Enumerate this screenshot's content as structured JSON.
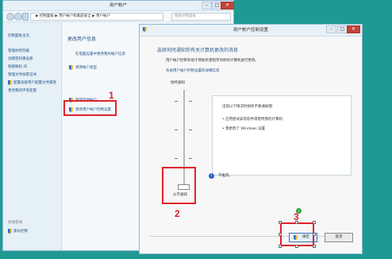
{
  "back_window": {
    "title": "用户帐户",
    "address": "▶ 控制面板 ▶ 用户帐户和家庭安全 ▶ 用户帐户",
    "search_placeholder": "搜索控制面板",
    "buttons": [
      "–",
      "□",
      "✕"
    ],
    "sidebar": {
      "items": [
        "控制面板主页",
        "管理你的凭据",
        "创建密码重设盘",
        "链接联机 ID",
        "管理文件加密证书",
        "配置高级用户配置文件属性",
        "更改我的环境变量"
      ],
      "footer_label": "另请参阅",
      "footer_link": "家长控制"
    },
    "main": {
      "heading": "更改用户信息",
      "links": [
        "在电脑设置中更改我的帐户信息",
        "更改帐户类型",
        "管理其他帐户",
        "更改用户帐户控制设置"
      ]
    }
  },
  "front_window": {
    "title": "用户帐户控制设置",
    "buttons": [
      "–",
      "□",
      "✕"
    ],
    "heading": "选择何时通知你有关计算机更改的消息",
    "description": "用户帐户控制有助于预防有害程序对你的计算机进行更改。",
    "learn_more_link": "有关用户帐户控制设置的详细信息",
    "slider": {
      "top_label": "始终通知",
      "bottom_label": "从不通知",
      "level": 0
    },
    "info_box": {
      "heading": "出现以下情况时始终不要通知我:",
      "bullets": [
        "应用尝试安装软件或更改我的计算机",
        "我更改了 Windows 设置"
      ]
    },
    "note": "不推荐。",
    "ok_label": "确定",
    "cancel_label": "取消"
  },
  "annotations": {
    "step1": "1",
    "step2": "2",
    "step3": "3",
    "highlight_color": "#e0232d"
  }
}
